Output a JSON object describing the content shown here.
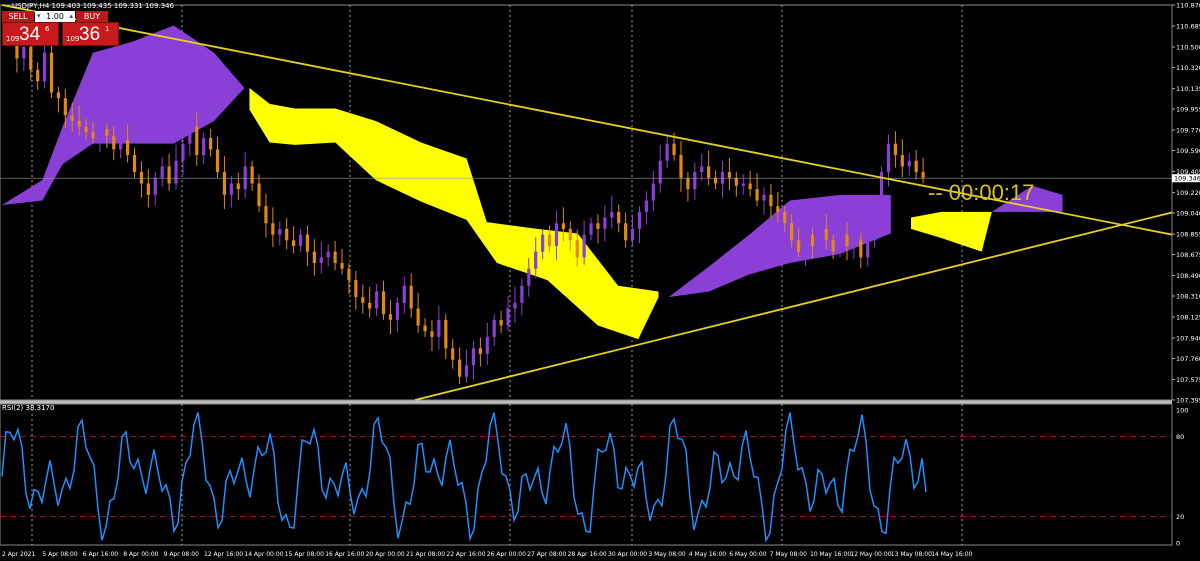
{
  "header": {
    "title": "USDJPY,H4  109.403 109.435 109.331 109.346"
  },
  "trade": {
    "sell_label": "SELL",
    "buy_label": "BUY",
    "lot_value": "1.00",
    "sell_small": "109",
    "sell_big": "34",
    "sell_sup": "6",
    "buy_small": "109",
    "buy_big": "36",
    "buy_sup": "1"
  },
  "countdown": "-- 00:00:17",
  "rsi_title": "RSI(2) 38.3170",
  "colors": {
    "bull": "#8a3fd6",
    "bear": "#e08a14",
    "cloud_bull": "#8a3fd6",
    "cloud_bear": "#ffff00",
    "trendline": "#e6d21c",
    "rsi": "#1e90ff",
    "rsi_level": "#c0202a",
    "grid": "#c8c8c8"
  },
  "chart_data": [
    {
      "type": "candlestick",
      "symbol": "USDJPY",
      "timeframe": "H4",
      "y_ticks": [
        "110.870",
        "110.685",
        "110.500",
        "110.320",
        "110.135",
        "109.955",
        "109.770",
        "109.590",
        "109.405",
        "109.220",
        "109.040",
        "108.855",
        "108.675",
        "108.490",
        "108.310",
        "108.125",
        "107.940",
        "107.760",
        "107.575",
        "107.395"
      ],
      "ylim": [
        107.395,
        110.87
      ],
      "x_ticks": [
        "2 Apr 2021",
        "5 Apr 08:00",
        "6 Apr 16:00",
        "8 Apr 00:00",
        "9 Apr 08:00",
        "12 Apr 16:00",
        "14 Apr 00:00",
        "15 Apr 08:00",
        "16 Apr 16:00",
        "20 Apr 00:00",
        "21 Apr 08:00",
        "22 Apr 16:00",
        "26 Apr 00:00",
        "27 Apr 08:00",
        "28 Apr 16:00",
        "30 Apr 00:00",
        "3 May 08:00",
        "4 May 16:00",
        "6 May 00:00",
        "7 May 08:00",
        "10 May 16:00",
        "12 May 00:00",
        "13 May 08:00",
        "14 May 16:00"
      ],
      "last_price": "109.346",
      "indicators": [
        "Ichimoku cloud",
        "trend lines"
      ]
    },
    {
      "type": "line",
      "name": "RSI(2)",
      "value": 38.317,
      "ylim": [
        0,
        100
      ],
      "levels": [
        20,
        80
      ],
      "y_ticks": [
        "100",
        "80",
        "20",
        "0"
      ]
    }
  ]
}
